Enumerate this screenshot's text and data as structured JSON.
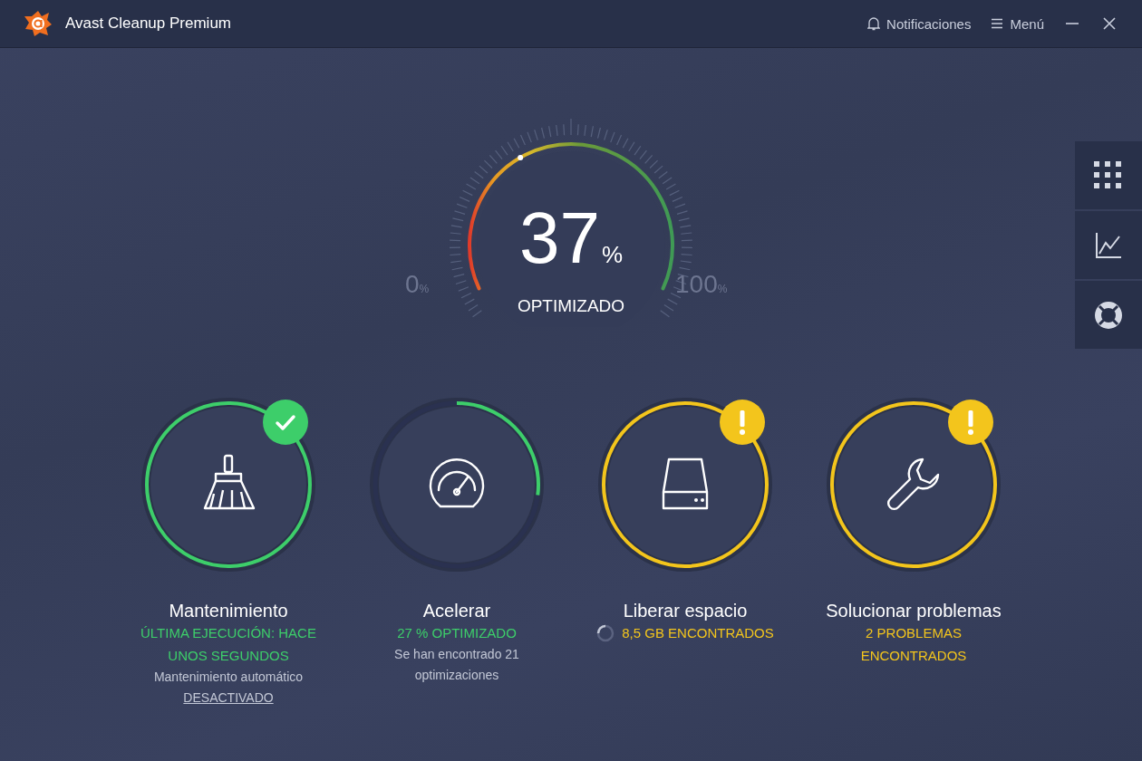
{
  "window": {
    "title": "Avast Cleanup Premium"
  },
  "header": {
    "notifications": "Notificaciones",
    "menu": "Menú"
  },
  "gauge": {
    "level": 0.37,
    "value": "37",
    "unit": "%",
    "label": "OPTIMIZADO",
    "min": "0",
    "min_unit": "%",
    "max": "100",
    "max_unit": "%"
  },
  "cards": [
    {
      "kind": "ok",
      "title": "Mantenimiento",
      "status": "ÚLTIMA EJECUCIÓN: HACE UNOS SEGUNDOS",
      "detail": "Mantenimiento automático",
      "link": "DESACTIVADO"
    },
    {
      "kind": "progress",
      "level": 0.27,
      "title": "Acelerar",
      "status": "27 % OPTIMIZADO",
      "detail": "Se han encontrado 21 optimizaciones"
    },
    {
      "kind": "warning",
      "loading": true,
      "title": "Liberar espacio",
      "status": "8,5 GB ENCONTRADOS"
    },
    {
      "kind": "warning",
      "title": "Solucionar problemas",
      "status": "2 PROBLEMAS ENCONTRADOS"
    }
  ]
}
